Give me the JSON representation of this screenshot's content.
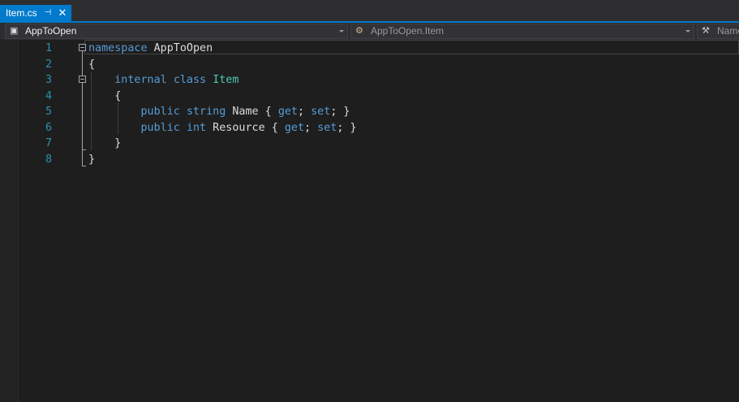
{
  "tabs": [
    {
      "label": "Item.cs",
      "pin_icon": "pin-icon",
      "close_icon": "close-icon",
      "active": true
    }
  ],
  "navbar": {
    "project": {
      "label": "AppToOpen",
      "icon": "csharp-project-icon"
    },
    "type": {
      "label": "AppToOpen.Item",
      "icon": "class-icon"
    },
    "member": {
      "label": "Name",
      "icon": "wrench-icon"
    }
  },
  "colors": {
    "accent": "#007acc",
    "keyword": "#569cd6",
    "type": "#4ec9b0",
    "line_number": "#2b91af",
    "text": "#dcdcdc",
    "background": "#1e1e1e"
  },
  "editor": {
    "lines": [
      {
        "n": "1",
        "tokens": [
          {
            "t": "namespace",
            "c": "kw"
          },
          {
            "t": " AppToOpen",
            "c": ""
          }
        ]
      },
      {
        "n": "2",
        "tokens": [
          {
            "t": "{",
            "c": ""
          }
        ]
      },
      {
        "n": "3",
        "tokens": [
          {
            "t": "    ",
            "c": ""
          },
          {
            "t": "internal",
            "c": "kw"
          },
          {
            "t": " ",
            "c": ""
          },
          {
            "t": "class",
            "c": "kw"
          },
          {
            "t": " ",
            "c": ""
          },
          {
            "t": "Item",
            "c": "tp"
          }
        ]
      },
      {
        "n": "4",
        "tokens": [
          {
            "t": "    {",
            "c": ""
          }
        ]
      },
      {
        "n": "5",
        "tokens": [
          {
            "t": "        ",
            "c": ""
          },
          {
            "t": "public",
            "c": "kw"
          },
          {
            "t": " ",
            "c": ""
          },
          {
            "t": "string",
            "c": "kw"
          },
          {
            "t": " Name { ",
            "c": ""
          },
          {
            "t": "get",
            "c": "kw"
          },
          {
            "t": "; ",
            "c": ""
          },
          {
            "t": "set",
            "c": "kw"
          },
          {
            "t": "; }",
            "c": ""
          }
        ]
      },
      {
        "n": "6",
        "tokens": [
          {
            "t": "        ",
            "c": ""
          },
          {
            "t": "public",
            "c": "kw"
          },
          {
            "t": " ",
            "c": ""
          },
          {
            "t": "int",
            "c": "kw"
          },
          {
            "t": " Resource { ",
            "c": ""
          },
          {
            "t": "get",
            "c": "kw"
          },
          {
            "t": "; ",
            "c": ""
          },
          {
            "t": "set",
            "c": "kw"
          },
          {
            "t": "; }",
            "c": ""
          }
        ]
      },
      {
        "n": "7",
        "tokens": [
          {
            "t": "    }",
            "c": ""
          }
        ]
      },
      {
        "n": "8",
        "tokens": [
          {
            "t": "}",
            "c": ""
          }
        ]
      }
    ]
  }
}
